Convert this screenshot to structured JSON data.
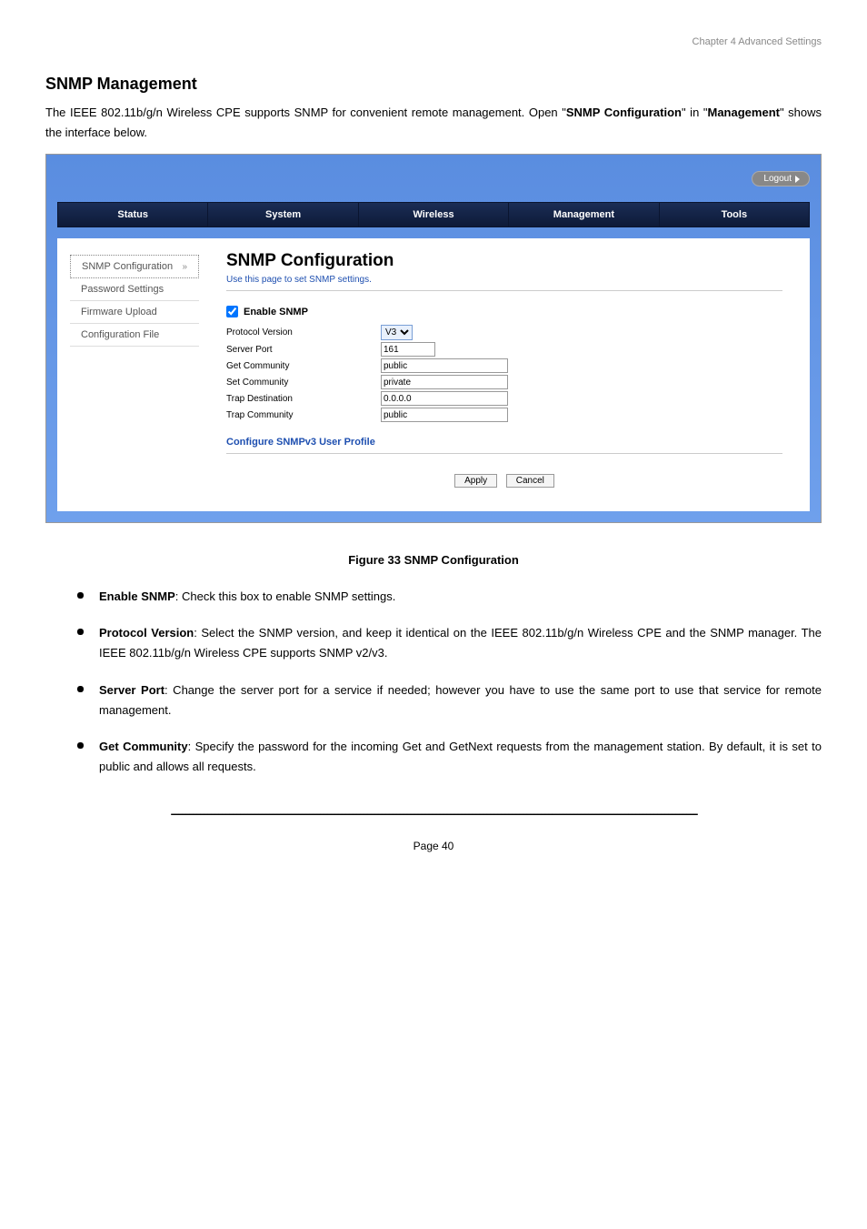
{
  "doc_header": "Chapter 4 Advanced Settings",
  "section_title": "SNMP Management",
  "intro": "The IEEE 802.11b/g/n Wireless CPE supports SNMP for convenient remote management. Open \"SNMP Configuration\" in \"Management\" shows the interface below.",
  "figure": {
    "logout": "Logout",
    "nav": [
      "Status",
      "System",
      "Wireless",
      "Management",
      "Tools"
    ],
    "sidebar": [
      {
        "label": "SNMP Configuration",
        "active": true
      },
      {
        "label": "Password Settings",
        "active": false
      },
      {
        "label": "Firmware Upload",
        "active": false
      },
      {
        "label": "Configuration File",
        "active": false
      }
    ],
    "page_title": "SNMP Configuration",
    "page_subtitle": "Use this page to set SNMP settings.",
    "enable_label": "Enable SNMP",
    "fields": {
      "protocol_version": {
        "label": "Protocol Version",
        "value": "V3"
      },
      "server_port": {
        "label": "Server Port",
        "value": "161"
      },
      "get_community": {
        "label": "Get Community",
        "value": "public"
      },
      "set_community": {
        "label": "Set Community",
        "value": "private"
      },
      "trap_destination": {
        "label": "Trap Destination",
        "value": "0.0.0.0"
      },
      "trap_community": {
        "label": "Trap Community",
        "value": "public"
      }
    },
    "profile_link": "Configure SNMPv3 User Profile",
    "apply": "Apply",
    "cancel": "Cancel"
  },
  "figure_caption": "Figure 33 SNMP Configuration",
  "bullets": [
    {
      "label": "Enable SNMP",
      "text": ": Check this box to enable SNMP settings."
    },
    {
      "label": "Protocol Version",
      "text": ": Select the SNMP version, and keep it identical on the IEEE 802.11b/g/n Wireless CPE and the SNMP manager. The IEEE 802.11b/g/n Wireless CPE supports SNMP v2/v3."
    },
    {
      "label": "Server Port",
      "text": ": Change the server port for a service if needed; however you have to use the same port to use that service for remote management."
    },
    {
      "label": "Get Community",
      "text": ": Specify the password for the incoming Get and GetNext requests from the management station. By default, it is set to public and allows all requests."
    }
  ],
  "footer_pagenum": "Page 40"
}
